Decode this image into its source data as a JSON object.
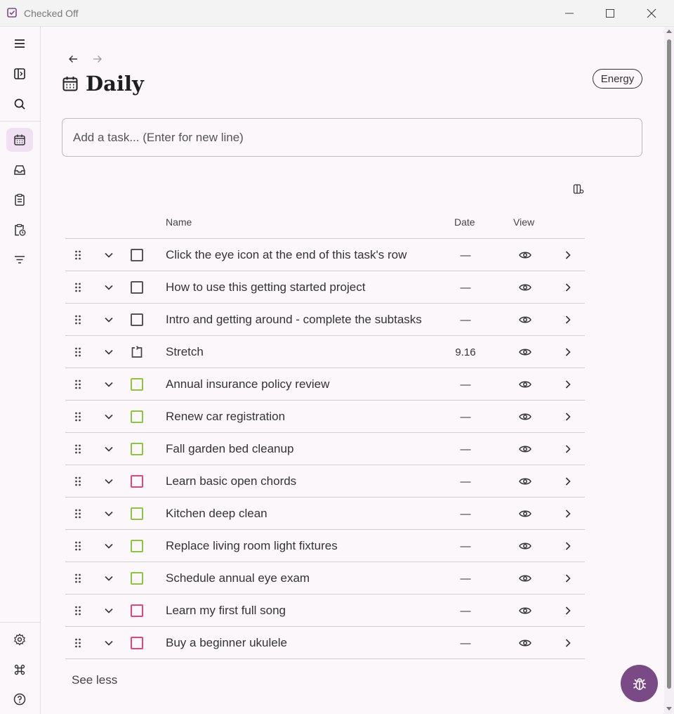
{
  "window": {
    "title": "Checked Off",
    "minimize_icon": "minimize-icon",
    "maximize_icon": "maximize-icon",
    "close_icon": "close-icon"
  },
  "sidebar": {
    "top_items": [
      {
        "name": "menu",
        "icon": "hamburger-icon"
      },
      {
        "name": "toggle-panel",
        "icon": "sidebar-toggle-icon"
      },
      {
        "name": "search",
        "icon": "search-icon"
      }
    ],
    "nav_items": [
      {
        "name": "daily",
        "icon": "calendar-icon",
        "active": true
      },
      {
        "name": "inbox",
        "icon": "inbox-icon"
      },
      {
        "name": "projects",
        "icon": "clipboard-icon"
      },
      {
        "name": "scheduled",
        "icon": "clipboard-clock-icon"
      },
      {
        "name": "filters",
        "icon": "filter-icon"
      }
    ],
    "bottom_items": [
      {
        "name": "settings",
        "icon": "gear-icon"
      },
      {
        "name": "shortcuts",
        "icon": "command-icon"
      },
      {
        "name": "help",
        "icon": "help-icon"
      }
    ]
  },
  "header": {
    "title": "Daily",
    "title_icon": "calendar-icon",
    "energy_label": "Energy"
  },
  "task_input": {
    "placeholder": "Add a task... (Enter for new line)",
    "value": ""
  },
  "table": {
    "columns": {
      "name": "Name",
      "date": "Date",
      "view": "View"
    },
    "rows": [
      {
        "name": "Click the eye icon at the end of this task's row",
        "date": "—",
        "check": "plain"
      },
      {
        "name": "How to use this getting started project",
        "date": "—",
        "check": "plain"
      },
      {
        "name": "Intro and getting around - complete the subtasks",
        "date": "—",
        "check": "plain"
      },
      {
        "name": "Stretch",
        "date": "9.16",
        "check": "recurring"
      },
      {
        "name": "Annual insurance policy review",
        "date": "—",
        "check": "green"
      },
      {
        "name": "Renew car registration",
        "date": "—",
        "check": "green"
      },
      {
        "name": "Fall garden bed cleanup",
        "date": "—",
        "check": "green"
      },
      {
        "name": "Learn basic open chords",
        "date": "—",
        "check": "pink"
      },
      {
        "name": "Kitchen deep clean",
        "date": "—",
        "check": "green"
      },
      {
        "name": "Replace living room light fixtures",
        "date": "—",
        "check": "green"
      },
      {
        "name": "Schedule annual eye exam",
        "date": "—",
        "check": "green"
      },
      {
        "name": "Learn my first full song",
        "date": "—",
        "check": "pink"
      },
      {
        "name": "Buy a beginner ukulele",
        "date": "—",
        "check": "pink"
      }
    ]
  },
  "footer": {
    "see_less_label": "See less"
  },
  "colors": {
    "accent": "#7a4a86",
    "green": "#8cc63f",
    "pink": "#e0457b",
    "plain": "#555555",
    "active_nav": "#efe1f2"
  },
  "fab": {
    "icon": "bug-icon"
  }
}
